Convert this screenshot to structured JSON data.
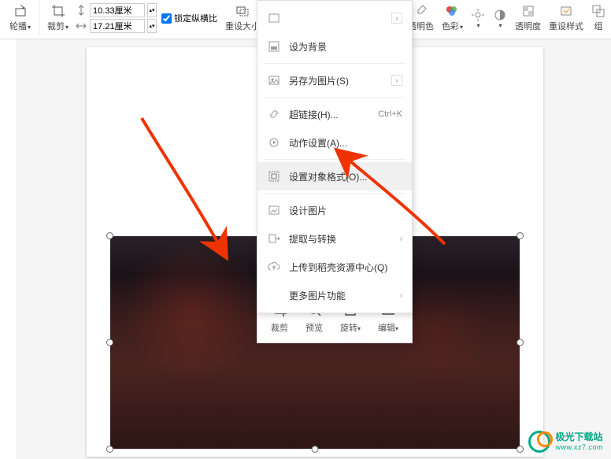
{
  "ribbon": {
    "rotate_label": "轮播",
    "crop_label": "裁剪",
    "height_value": "10.33厘米",
    "width_value": "17.21厘米",
    "lock_ratio_label": "锁定纵横比",
    "reset_size_label": "重设大小",
    "transparent_color_label": "透明色",
    "color_label": "色彩",
    "transparency_label": "透明度",
    "reset_style_label": "重设样式",
    "group_label": "组"
  },
  "menu": {
    "set_background": "设为背景",
    "save_as_image": "另存为图片(S)",
    "hyperlink": "超链接(H)...",
    "hyperlink_shortcut": "Ctrl+K",
    "action_settings": "动作设置(A)...",
    "format_object": "设置对象格式(O)...",
    "design_image": "设计图片",
    "extract_convert": "提取与转换",
    "upload_docer": "上传到稻壳资源中心(Q)",
    "more_image_funcs": "更多图片功能"
  },
  "quicktools": {
    "crop": "裁剪",
    "preview": "预览",
    "rotate": "旋转",
    "edit": "编辑"
  },
  "watermark": {
    "title": "极光下载站",
    "url": "www.xz7.com"
  }
}
